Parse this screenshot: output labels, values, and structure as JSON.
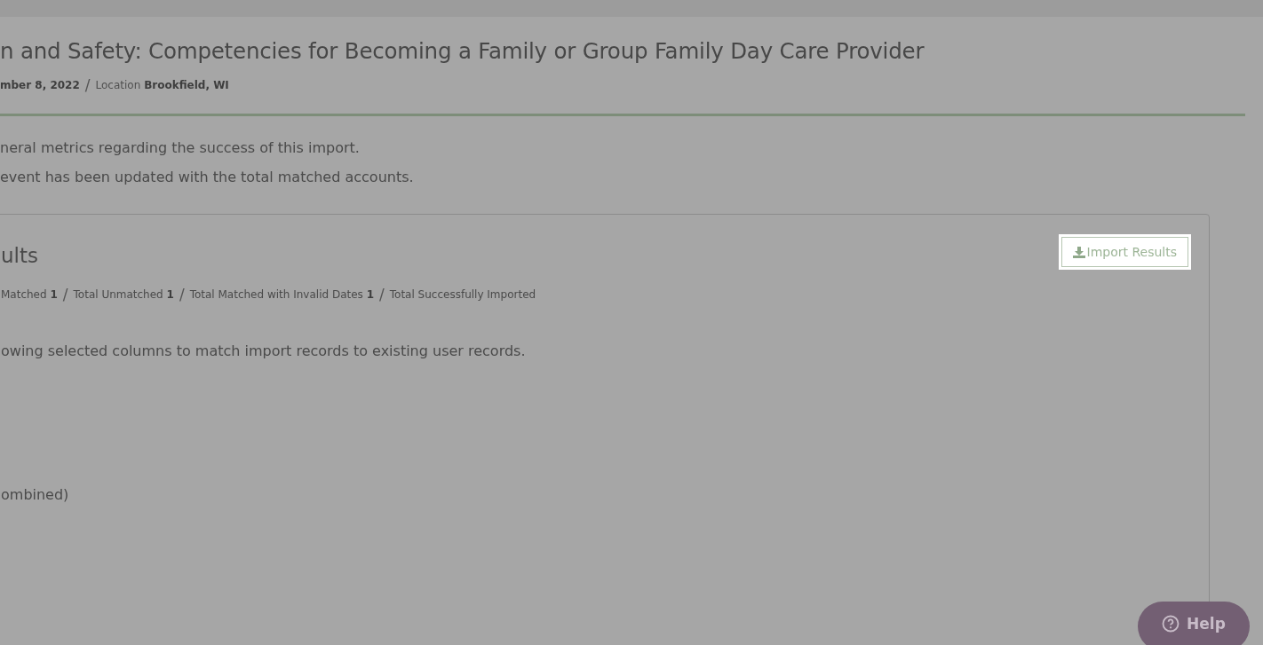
{
  "event": {
    "title": "n and Safety: Competencies for Becoming a Family or Group Family Day Care Provider",
    "meta": [
      {
        "value": "mber 8, 2022"
      },
      {
        "label": "Location",
        "value": "Brookfield, WI"
      }
    ],
    "separator": "/"
  },
  "intro": [
    "neral metrics regarding the success of this import.",
    "event has been updated with the total matched accounts."
  ],
  "results": {
    "heading": "ults",
    "stats": [
      {
        "label": "Matched",
        "value": "1"
      },
      {
        "label": "Total Unmatched",
        "value": "1"
      },
      {
        "label": "Total Matched with Invalid Dates",
        "value": "1"
      },
      {
        "label": "Total Successfully Imported"
      }
    ],
    "note": "owing selected columns to match import records to existing user records.",
    "column_note": "ombined)",
    "button": "Import Results"
  },
  "help": {
    "label": "Help"
  }
}
